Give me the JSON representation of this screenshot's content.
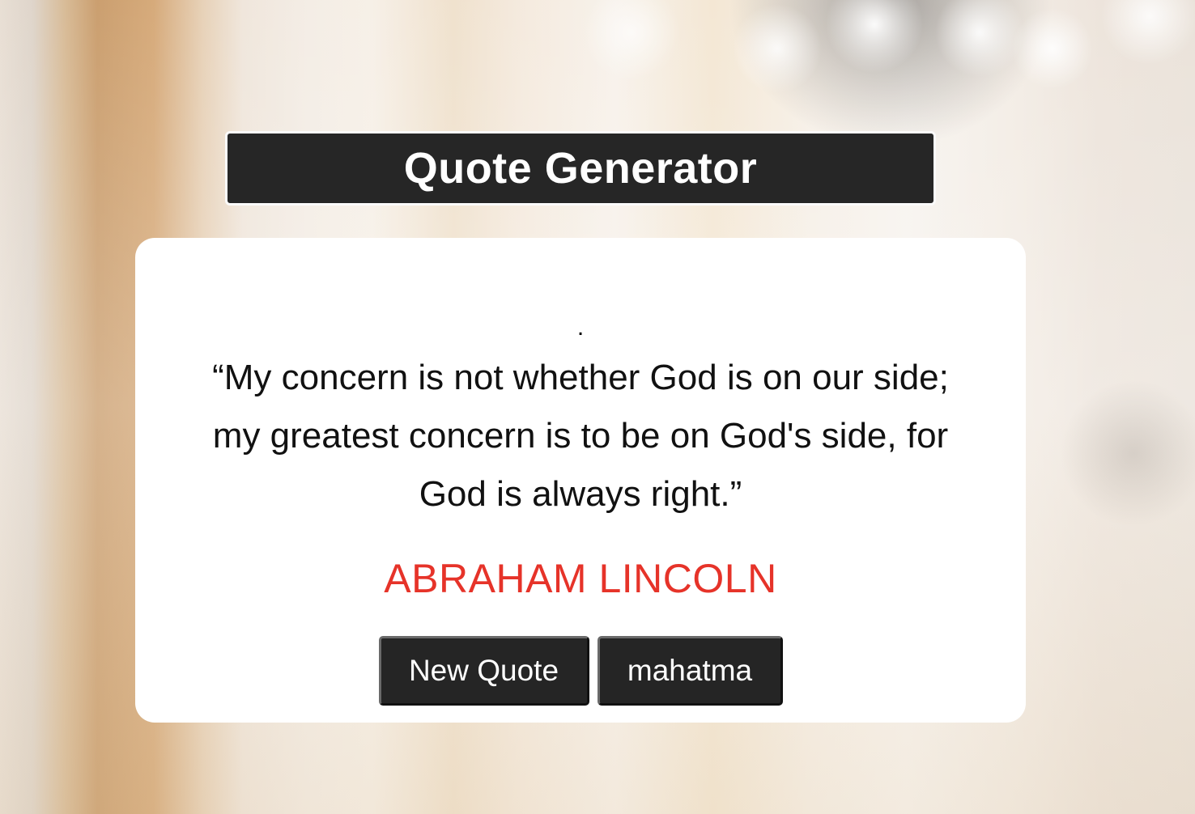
{
  "app": {
    "title": "Quote Generator"
  },
  "quote": {
    "marker": ".",
    "text": "“My concern is not whether God is on our side; my greatest concern is to be on God's side, for God is always right.”",
    "author": "ABRAHAM LINCOLN"
  },
  "buttons": {
    "new_quote_label": "New Quote",
    "mahatma_label": "mahatma"
  },
  "colors": {
    "title_bar": "#262626",
    "author": "#e63329",
    "button": "#252525",
    "card": "#ffffff"
  }
}
